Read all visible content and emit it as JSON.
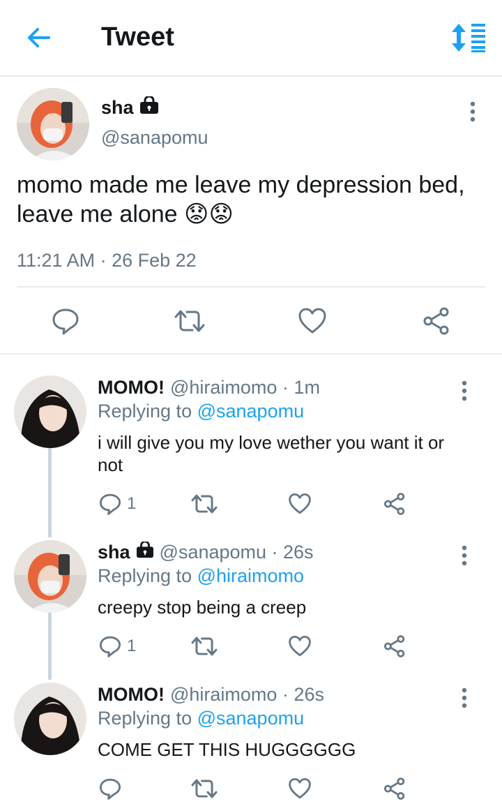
{
  "header": {
    "title": "Tweet"
  },
  "main_tweet": {
    "name": "sha",
    "handle": "@sanapomu",
    "text": "momo made me leave my depression bed, leave me alone 😟😟",
    "timestamp": "11:21 AM · 26 Feb 22"
  },
  "replies": [
    {
      "name": "MOMO!",
      "meta": "@hiraimomo · 1m",
      "replying_prefix": "Replying to ",
      "replying_to": "@sanapomu",
      "text": "i will give you my love wether you want it or not",
      "reply_count": "1",
      "locked": false
    },
    {
      "name": "sha",
      "meta": "@sanapomu · 26s",
      "replying_prefix": "Replying to ",
      "replying_to": "@hiraimomo",
      "text": "creepy stop being a creep",
      "reply_count": "1",
      "locked": true
    },
    {
      "name": "MOMO!",
      "meta": "@hiraimomo · 26s",
      "replying_prefix": "Replying to ",
      "replying_to": "@sanapomu",
      "text": "COME GET THIS HUGGGGGG",
      "reply_count": "",
      "locked": false
    }
  ],
  "colors": {
    "accent": "#1da1f2",
    "secondary_text": "#657786",
    "divider": "#e6ecf0",
    "thread_line": "#ccd6dd"
  }
}
